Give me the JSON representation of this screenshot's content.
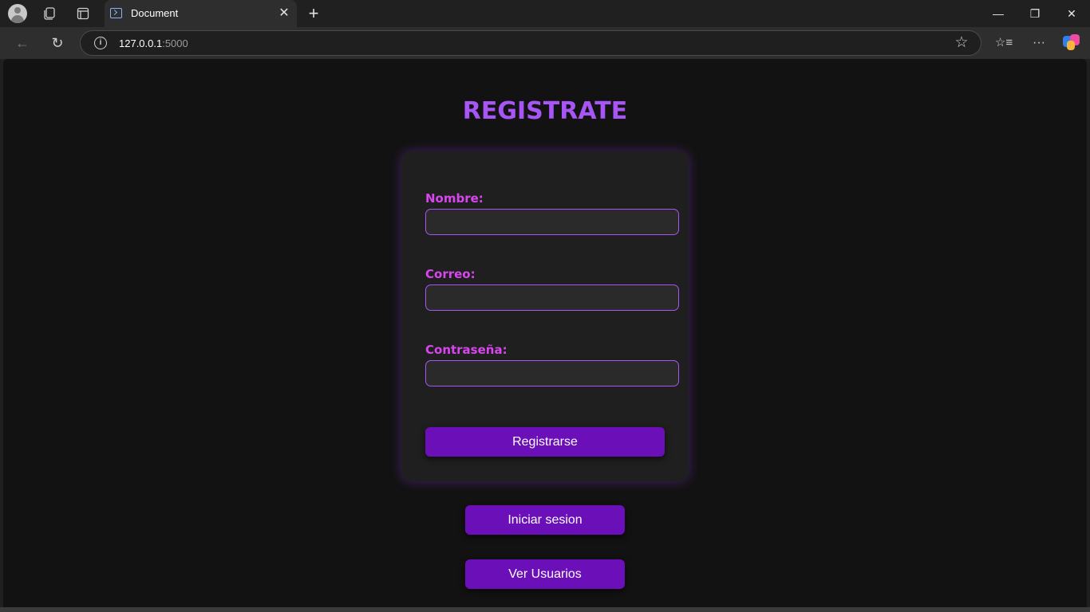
{
  "browser": {
    "tab_title": "Document",
    "url_host": "127.0.0.1",
    "url_port": ":5000",
    "icons": {
      "profile": "avatar-icon",
      "workspaces": "workspaces-icon",
      "tab_actions": "tab-actions-icon",
      "new_tab": "+",
      "close_tab": "✕",
      "back": "←",
      "refresh": "↻",
      "favorite": "☆",
      "favorites": "☆≡",
      "more": "···",
      "minimize": "—",
      "restore": "❐",
      "close": "✕"
    }
  },
  "page": {
    "title": "REGISTRATE",
    "form": {
      "name_label": "Nombre:",
      "name_value": "",
      "email_label": "Correo:",
      "email_value": "",
      "password_label": "Contraseña:",
      "password_value": "",
      "submit_label": "Registrarse"
    },
    "login_label": "Iniciar sesion",
    "users_label": "Ver Usuarios"
  },
  "colors": {
    "accent_title": "#a855f7",
    "label": "#d946ef",
    "button": "#6b0fb8",
    "background": "#121212",
    "card": "#1f1f1f"
  }
}
